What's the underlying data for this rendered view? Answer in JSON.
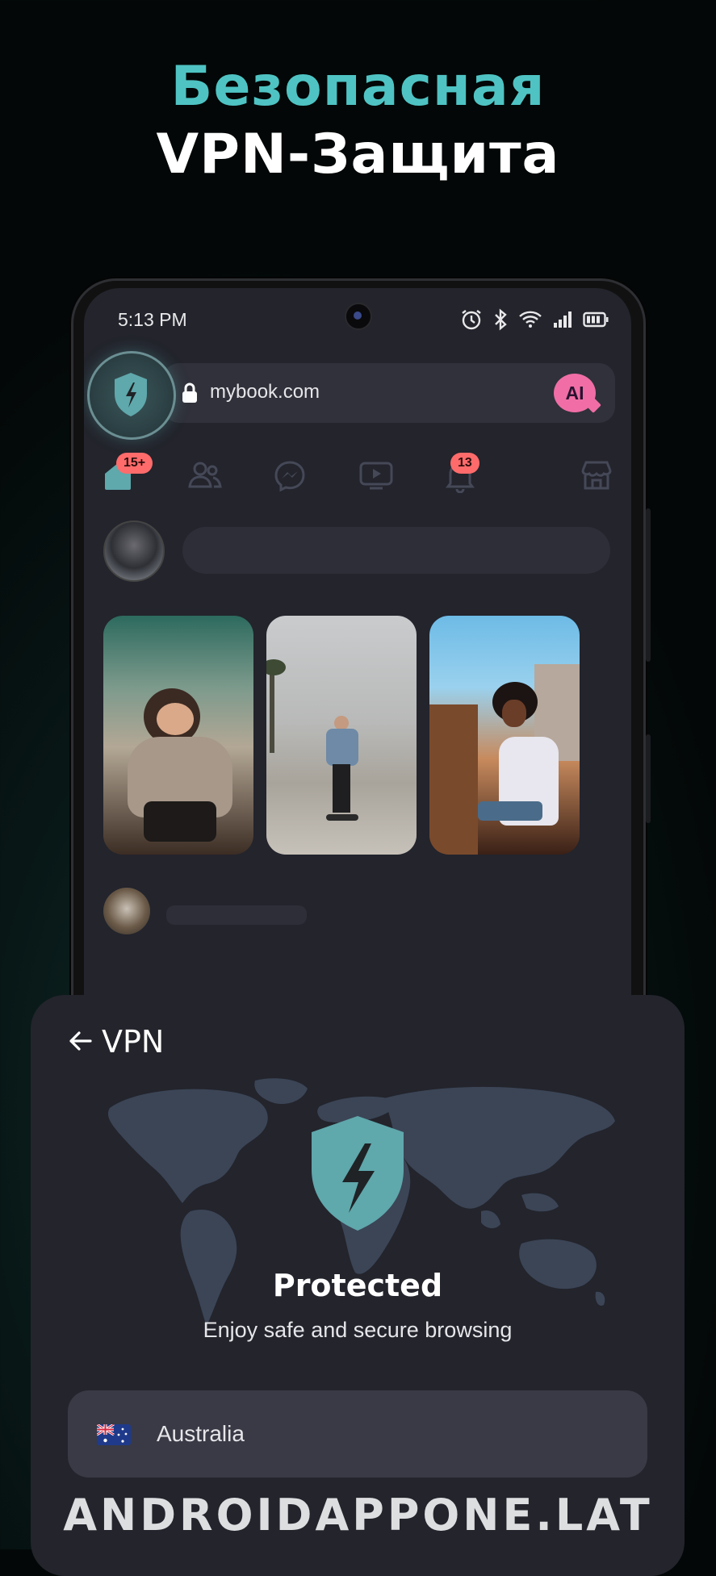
{
  "promo": {
    "headline_line1": "Безопасная",
    "headline_line2": "VPN-Защита",
    "headline_accent_color": "#4fc3c3"
  },
  "status_bar": {
    "time": "5:13 PM",
    "icons": [
      "alarm-icon",
      "bluetooth-icon",
      "wifi-icon",
      "signal-icon",
      "battery-icon"
    ]
  },
  "browser": {
    "url": "mybook.com",
    "ai_button_label": "AI",
    "vpn_button_icon": "shield-bolt-icon"
  },
  "social_nav": {
    "items": [
      {
        "icon": "home-icon",
        "badge": "15+"
      },
      {
        "icon": "friends-icon",
        "badge": ""
      },
      {
        "icon": "messenger-icon",
        "badge": ""
      },
      {
        "icon": "video-icon",
        "badge": ""
      },
      {
        "icon": "bell-icon",
        "badge": "13"
      },
      {
        "icon": "marketplace-icon",
        "badge": ""
      }
    ]
  },
  "vpn_panel": {
    "title": "VPN",
    "status_title": "Protected",
    "status_subtitle": "Enjoy safe and secure browsing",
    "country": "Australia",
    "shield_color": "#5fa8ac"
  },
  "watermark": "ANDROIDAPPONE.LAT"
}
